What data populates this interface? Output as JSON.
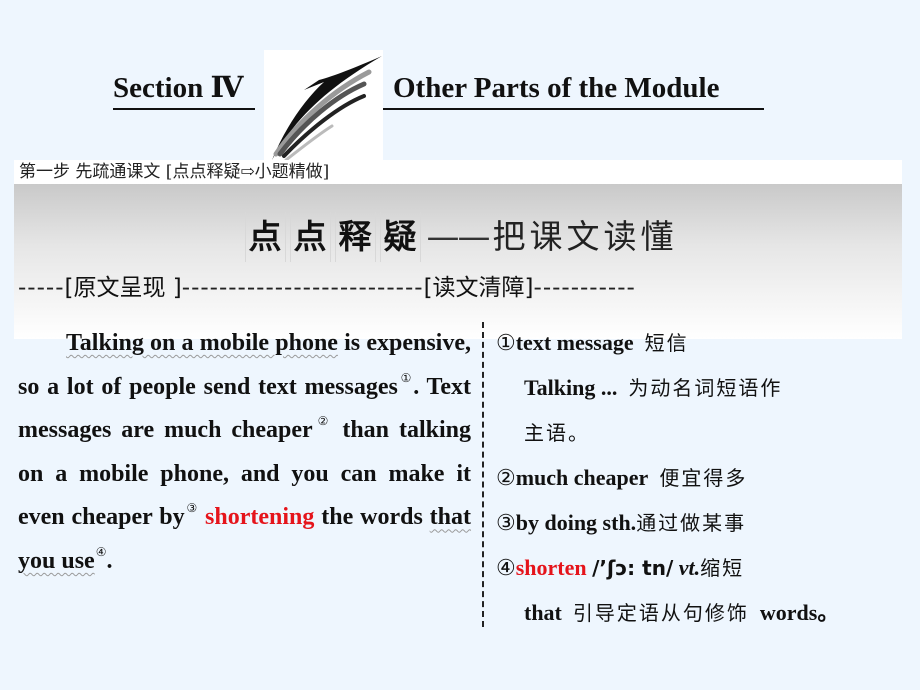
{
  "header": {
    "section_label": "Section Ⅳ",
    "module_title": "Other Parts of the Module",
    "logo_icon": "brush-stroke-logo"
  },
  "step_bar": {
    "text": "第一步  先疏通课文  [点点释疑⇨小题精做]"
  },
  "band": {
    "title_chars": [
      "点",
      "点",
      "释",
      "疑"
    ],
    "title_dash": "——",
    "subtitle": "把课文读懂",
    "left_label": "[原文呈现 ]",
    "right_label": "[读文清障]",
    "dashes_lead": "-----",
    "dashes_mid": "--------------------------",
    "dashes_tail": "-----------"
  },
  "passage": {
    "seg1_underlined": "Talking on a mobile phone",
    "seg2": " is expensive, so a lot of people send text messages",
    "note1": "①",
    "seg3": ". Text messages are much cheaper",
    "note2": "②",
    "seg4": " than talking on a mobile phone, and you can make it even cheaper by",
    "note3": "③",
    "seg5": " ",
    "highlight": "shortening",
    "seg6": " the words ",
    "seg7_underlined": "that you use",
    "note4": "④",
    "seg8": "."
  },
  "notes": [
    {
      "num": "①",
      "term": "text message",
      "meaning": "短信"
    },
    {
      "term": "Talking ...",
      "meaning": "为动名词短语作"
    },
    {
      "meaning": "主语。"
    },
    {
      "num": "②",
      "term": "much cheaper",
      "meaning": "便宜得多"
    },
    {
      "num": "③",
      "term": "by doing sth.",
      "meaning": "通过做某事"
    },
    {
      "num": "④",
      "term": "shorten",
      "phonetic": "/’ʃɔ: tn/",
      "pos": "vt.",
      "meaning": "缩短"
    },
    {
      "term": "that",
      "meaning": "引导定语从句修饰",
      "term2": "words。"
    }
  ],
  "colors": {
    "background": "#eef6fe",
    "highlight_red": "#e5141b",
    "band_gray": "#c9c9c9"
  }
}
